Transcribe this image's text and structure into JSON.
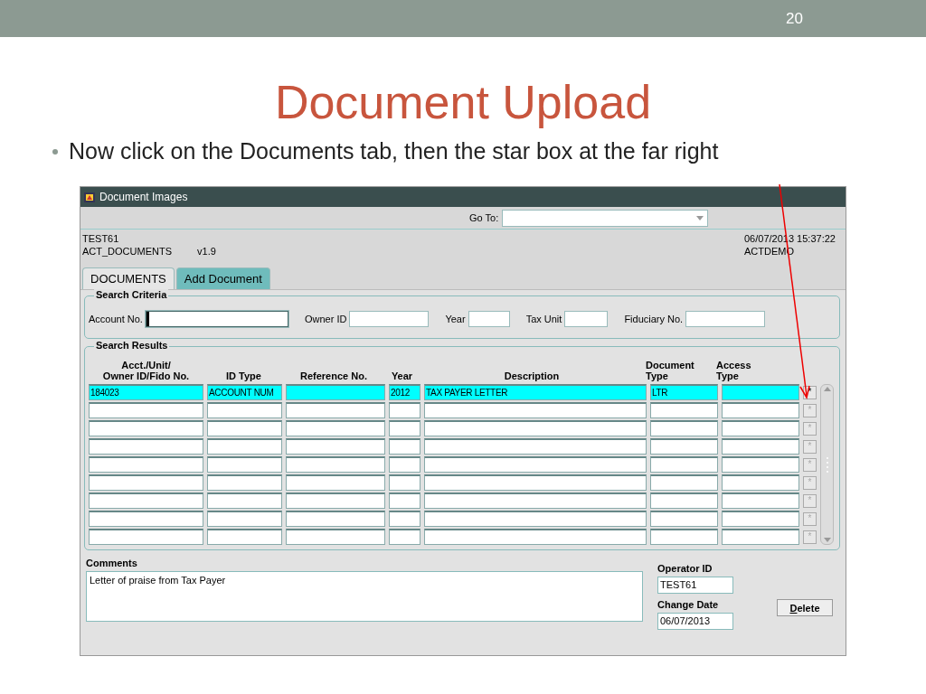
{
  "slide": {
    "number": "20",
    "title": "Document Upload",
    "bullets": [
      "Now click on the Documents tab, then the star box at the far right"
    ]
  },
  "window": {
    "title": "Document Images"
  },
  "goto": {
    "label": "Go To:"
  },
  "info": {
    "user": "TEST61",
    "form": "ACT_DOCUMENTS",
    "version": "v1.9",
    "timestamp": "06/07/2013 15:37:22",
    "database": "ACTDEMO"
  },
  "tabs": [
    {
      "label": "DOCUMENTS",
      "selected": true
    },
    {
      "label": "Add Document",
      "selected": false
    }
  ],
  "search_criteria": {
    "title": "Search Criteria",
    "fields": [
      {
        "label": "Account No.",
        "focused": true
      },
      {
        "label": "Owner ID",
        "focused": false
      },
      {
        "label": "Year",
        "focused": false
      },
      {
        "label": "Tax Unit",
        "focused": false
      },
      {
        "label": "Fiduciary No.",
        "focused": false
      }
    ]
  },
  "search_results": {
    "title": "Search Results",
    "columns": [
      "Acct./Unit/\nOwner ID/Fido No.",
      "ID Type",
      "Reference No.",
      "Year",
      "Description",
      "Document\nType",
      "Access\nType"
    ],
    "rows": [
      {
        "cells": [
          "184023",
          "ACCOUNT NUM",
          null,
          "2012",
          "TAX PAYER LETTER",
          "LTR",
          null
        ],
        "selected": true,
        "star": "*",
        "star_enabled": true
      },
      {
        "selected": false,
        "star": "*",
        "star_enabled": false
      },
      {
        "selected": false,
        "star": "*",
        "star_enabled": false
      },
      {
        "selected": false,
        "star": "*",
        "star_enabled": false
      },
      {
        "selected": false,
        "star": "*",
        "star_enabled": false
      },
      {
        "selected": false,
        "star": "*",
        "star_enabled": false
      },
      {
        "selected": false,
        "star": "*",
        "star_enabled": false
      },
      {
        "selected": false,
        "star": "*",
        "star_enabled": false
      },
      {
        "selected": false,
        "star": "*",
        "star_enabled": false
      }
    ]
  },
  "comments": {
    "label": "Comments",
    "value": "Letter of praise from Tax Payer"
  },
  "operator": {
    "label": "Operator ID",
    "value": "TEST61"
  },
  "change_date": {
    "label": "Change Date",
    "value": "06/07/2013"
  },
  "buttons": [
    {
      "label": "Delete"
    }
  ]
}
